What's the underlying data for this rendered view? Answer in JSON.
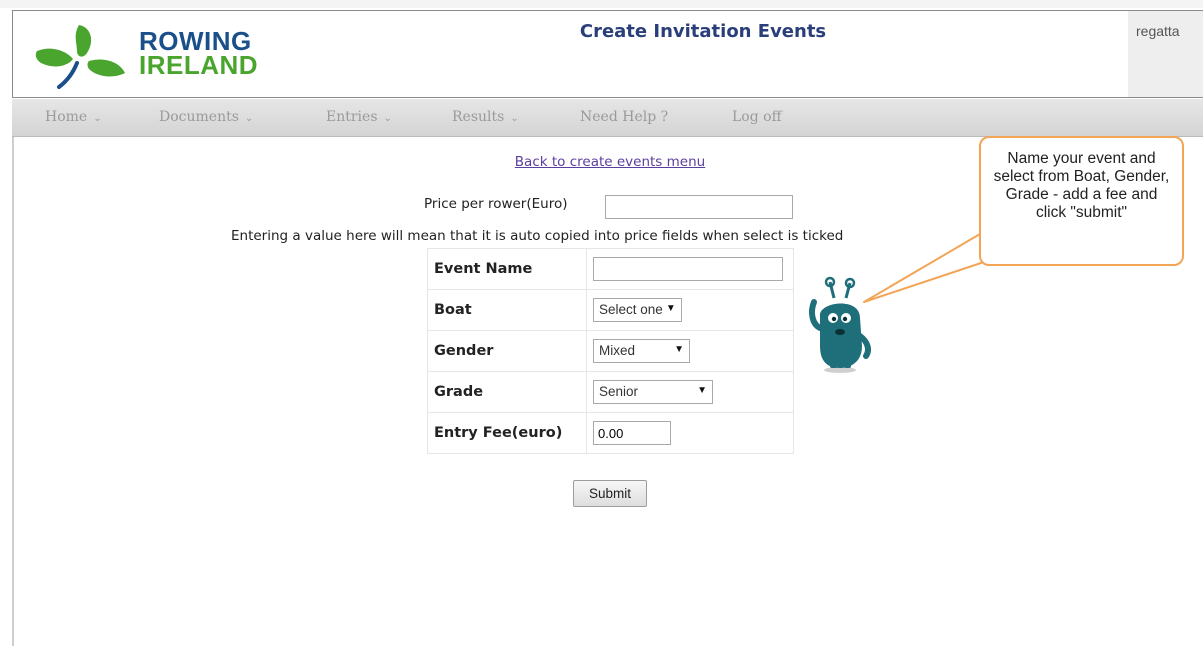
{
  "header": {
    "logo": {
      "line1": "ROWING",
      "line2": "IRELAND"
    },
    "title": "Create Invitation Events",
    "user_label": "regatta"
  },
  "nav": {
    "items": [
      {
        "label": "Home",
        "caret": "⌄"
      },
      {
        "label": "Documents",
        "caret": "⌄"
      },
      {
        "label": "Entries",
        "caret": "⌄"
      },
      {
        "label": "Results",
        "caret": "⌄"
      },
      {
        "label": "Need Help ?",
        "caret": ""
      },
      {
        "label": "Log off",
        "caret": ""
      }
    ]
  },
  "main": {
    "back_link": "Back to create events menu",
    "price_label": "Price per rower(Euro)",
    "price_value": "",
    "note": "Entering a value here will mean that it is auto copied into price fields when select is ticked",
    "form": {
      "event_name_label": "Event Name",
      "event_name_value": "",
      "boat_label": "Boat",
      "boat_selected": "Select one",
      "gender_label": "Gender",
      "gender_selected": "Mixed",
      "grade_label": "Grade",
      "grade_selected": "Senior",
      "fee_label": "Entry Fee(euro)",
      "fee_value": "0.00",
      "submit_label": "Submit"
    }
  },
  "callout": {
    "text": "Name your event and select from Boat, Gender, Grade - add a fee and click \"submit\""
  },
  "colors": {
    "callout_border": "#f2a557",
    "link": "#5b3f9e",
    "title": "#2a3f7a",
    "logo_blue": "#1b4f8a",
    "logo_green": "#4aa52e",
    "monster": "#1f6f7a"
  }
}
